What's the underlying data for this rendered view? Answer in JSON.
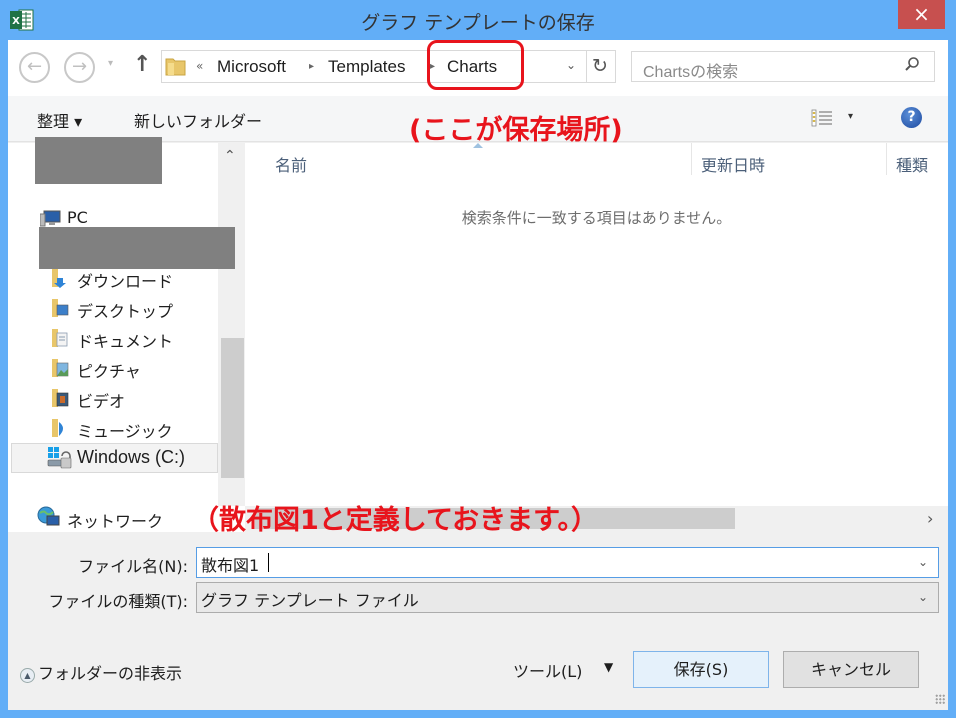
{
  "window": {
    "title": "グラフ テンプレートの保存",
    "app_icon": "excel-icon",
    "close_label": "×"
  },
  "nav": {
    "back_icon": "←",
    "forward_icon": "→",
    "recent_icon": "▾",
    "up_icon": "↑",
    "breadcrumb_overflow": "«",
    "breadcrumb": [
      "Microsoft",
      "Templates",
      "Charts"
    ],
    "separator": "▸",
    "dropdown_icon": "⌄",
    "refresh_icon": "↻",
    "search_placeholder": "Chartsの検索",
    "search_icon": "⚲"
  },
  "toolbar": {
    "organize_label": "整理 ▾",
    "new_folder_label": "新しいフォルダー",
    "view_dd_icon": "▾",
    "help_label": "?"
  },
  "sidebar": {
    "scroll_up": "⌃",
    "items": [
      {
        "label": "PC",
        "icon": "pc-icon"
      },
      {
        "label": "ダウンロード",
        "icon": "downloads-folder-icon"
      },
      {
        "label": "デスクトップ",
        "icon": "desktop-folder-icon"
      },
      {
        "label": "ドキュメント",
        "icon": "documents-folder-icon"
      },
      {
        "label": "ピクチャ",
        "icon": "pictures-folder-icon"
      },
      {
        "label": "ビデオ",
        "icon": "videos-folder-icon"
      },
      {
        "label": "ミュージック",
        "icon": "music-folder-icon"
      },
      {
        "label": "Windows (C:)",
        "icon": "drive-icon",
        "selected": true
      },
      {
        "label": "ネットワーク",
        "icon": "network-icon"
      }
    ]
  },
  "content": {
    "columns": [
      "名前",
      "更新日時",
      "種類"
    ],
    "empty_message": "検索条件に一致する項目はありません。",
    "hscroll_right": "›"
  },
  "form": {
    "filename_label": "ファイル名(N):",
    "filename_value": "散布図1",
    "filetype_label": "ファイルの種類(T):",
    "filetype_value": "グラフ テンプレート ファイル",
    "dropdown_icon": "⌄"
  },
  "footer": {
    "hide_folders_label": "フォルダーの非表示",
    "hide_icon": "▲",
    "tools_label": "ツール(L)",
    "tools_dd": "▼",
    "save_label": "保存(S)",
    "cancel_label": "キャンセル"
  },
  "annotations": {
    "location_note": "(ここが保存場所)",
    "name_note": "（散布図1と定義しておきます。）",
    "color": "#e8141c"
  }
}
